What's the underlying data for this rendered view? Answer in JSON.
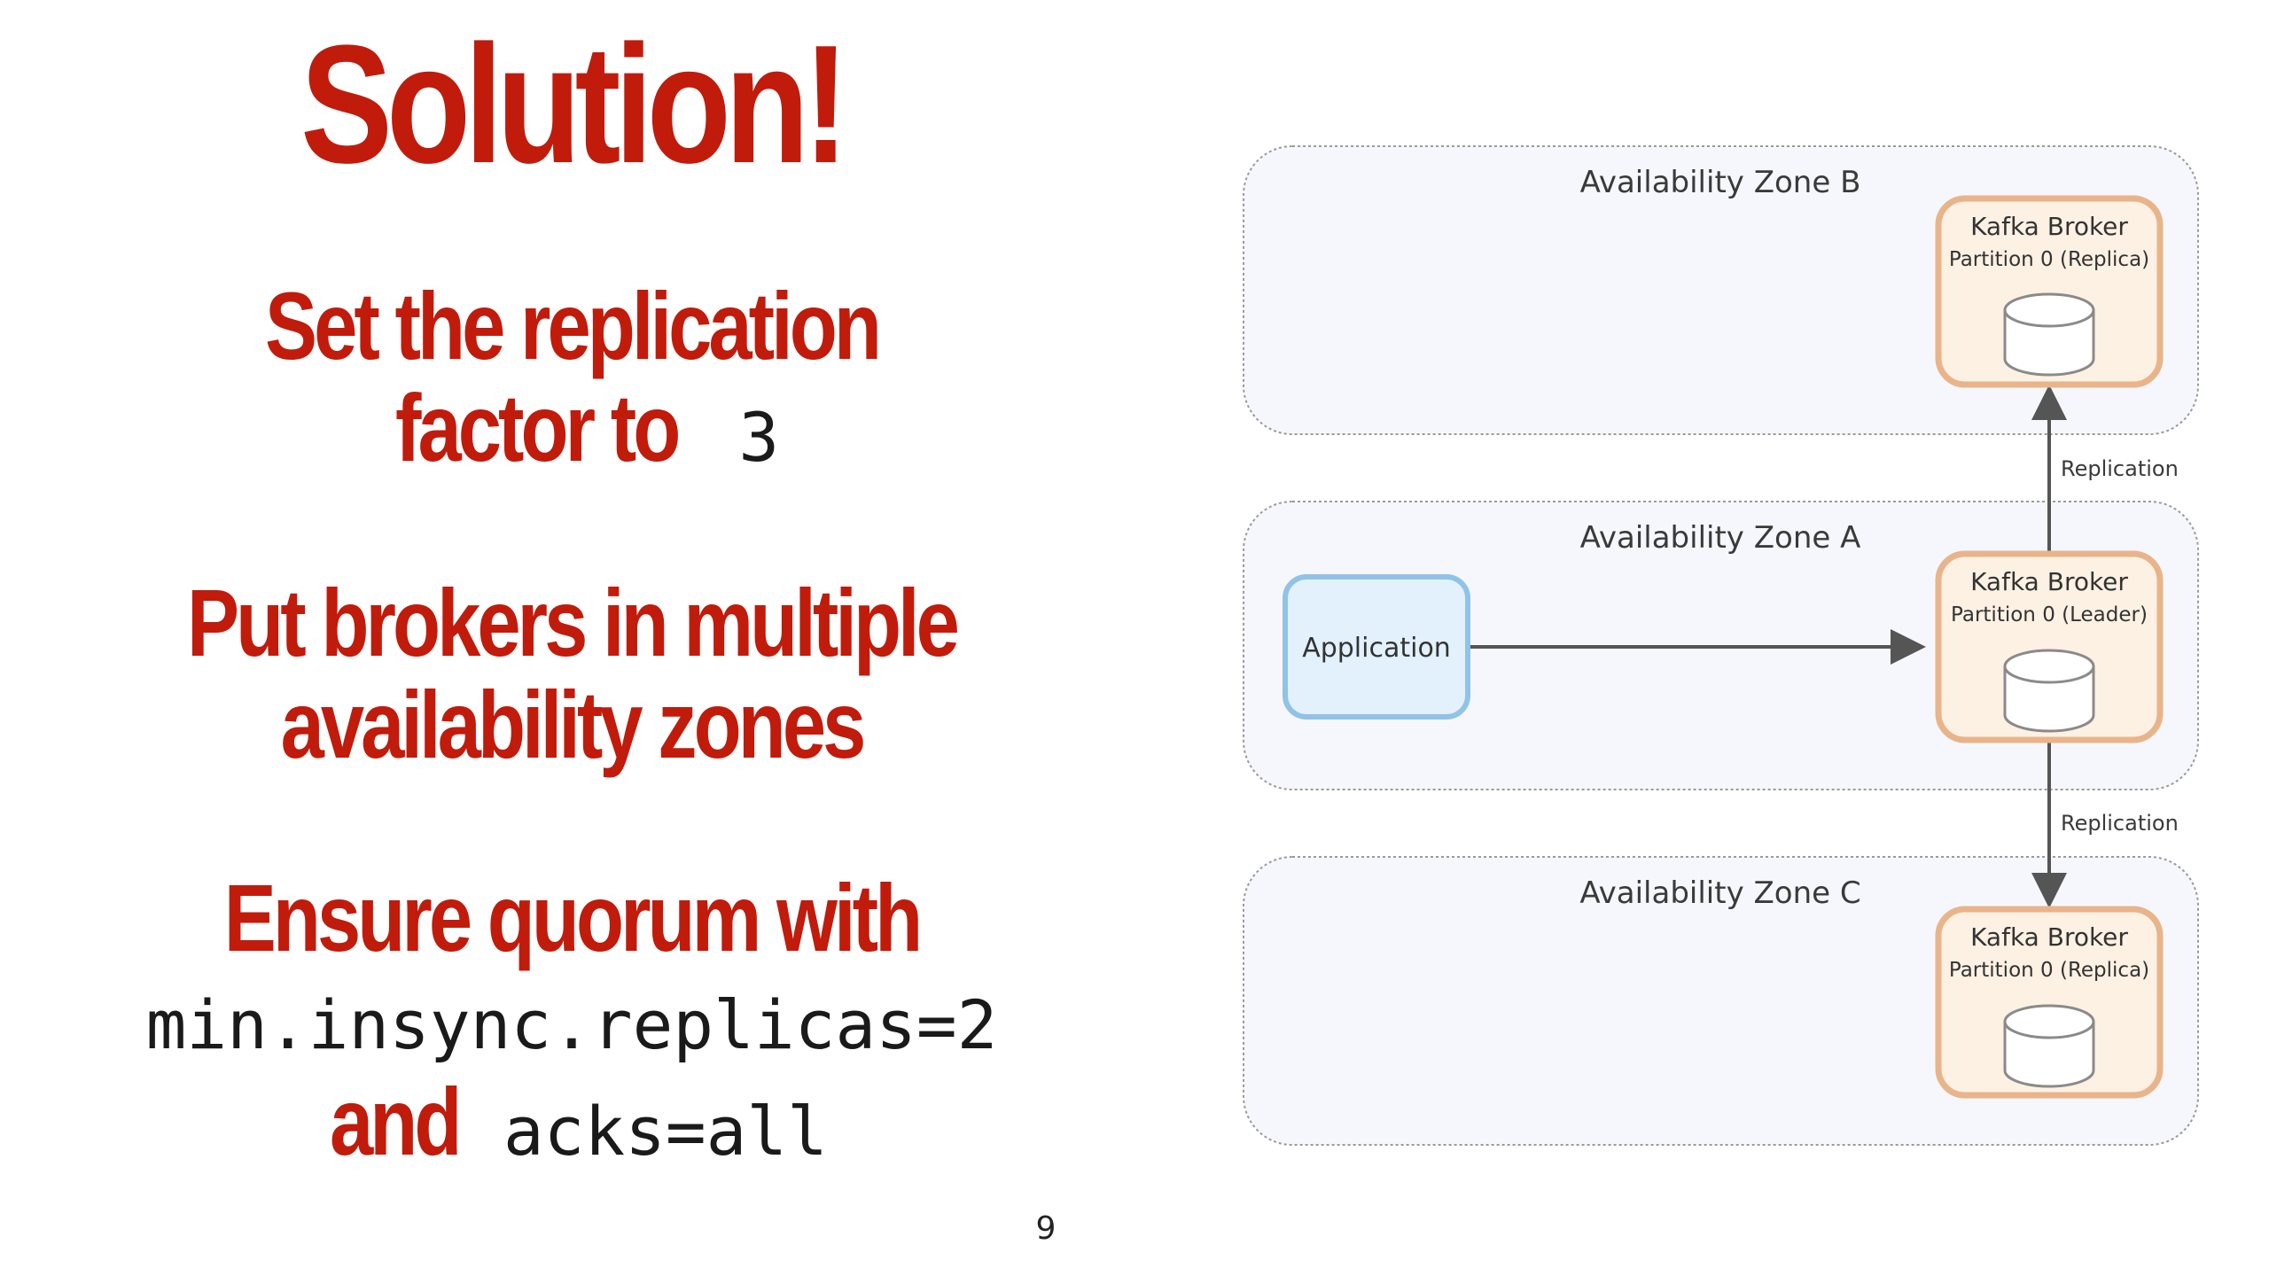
{
  "slide": {
    "title": "Solution!",
    "point1": {
      "line1": "Set the replication",
      "line2_text": "factor to",
      "line2_code": "3"
    },
    "point2": {
      "line1": "Put brokers in multiple",
      "line2": "availability zones"
    },
    "point3": {
      "line1": "Ensure quorum with",
      "code1": "min.insync.replicas=2",
      "and": "and",
      "code2": "acks=all"
    },
    "page_number": "9"
  },
  "diagram": {
    "zones": [
      {
        "label": "Availability Zone B"
      },
      {
        "label": "Availability Zone A"
      },
      {
        "label": "Availability Zone C"
      }
    ],
    "brokers": [
      {
        "title": "Kafka Broker",
        "subtitle": "Partition 0 (Replica)"
      },
      {
        "title": "Kafka Broker",
        "subtitle": "Partition 0 (Leader)"
      },
      {
        "title": "Kafka Broker",
        "subtitle": "Partition 0 (Replica)"
      }
    ],
    "application": {
      "label": "Application"
    },
    "edges": [
      {
        "label": "Replication"
      },
      {
        "label": "Replication"
      }
    ],
    "colors": {
      "accent_red": "#c11b0c",
      "zone_fill": "#f6f7fc",
      "zone_border": "#9a9a9a",
      "broker_fill": "#fdf1e4",
      "broker_border": "#e9b48a",
      "app_fill": "#e3f1fd",
      "app_border": "#91c3e6",
      "arrow": "#555555"
    }
  }
}
